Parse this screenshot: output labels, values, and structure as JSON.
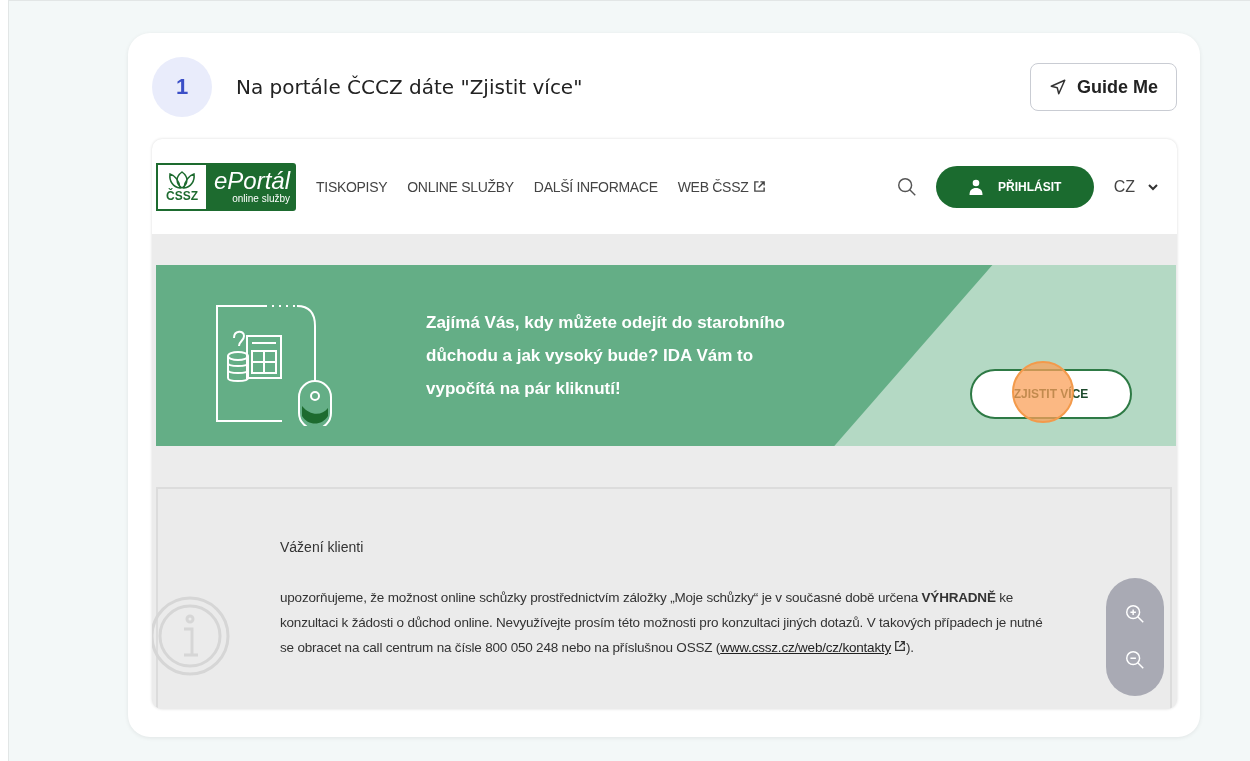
{
  "step": {
    "number": "1",
    "title": "Na portále ČCCZ dáte \"Zjistit více\"",
    "guide_button": "Guide Me"
  },
  "portal": {
    "logo": {
      "agency": "ČSSZ",
      "name": "ePortál",
      "tagline": "online služby"
    },
    "nav": [
      {
        "label": "TISKOPISY",
        "external": false
      },
      {
        "label": "ONLINE SLUŽBY",
        "external": false
      },
      {
        "label": "DALŠÍ INFORMACE",
        "external": false
      },
      {
        "label": "WEB ČSSZ",
        "external": true
      }
    ],
    "login_button": "PŘIHLÁSIT",
    "language": "CZ",
    "banner": {
      "text": "Zajímá Vás, kdy můžete odejít do starobního důchodu a jak vysoký bude? IDA Vám to vypočítá na pár kliknutí!",
      "button": "ZJISTIT VÍCE",
      "click_marker": true
    },
    "notice": {
      "greeting": "Vážení klienti",
      "text": "upozorňujeme, že možnost online schůzky prostřednictvím záložky „Moje schůzky“ je v současné době určena **VÝHRADNĚ** ke konzultaci k žádosti o důchod online. Nevyužívejte prosím této možnosti pro konzultaci jiných dotazů. V takových případech je nutné se obracet na call centrum na čísle 800 050 248 nebo na příslušnou OSSZ (",
      "link": "www.cssz.cz/web/cz/kontakty",
      "after": ")."
    }
  }
}
